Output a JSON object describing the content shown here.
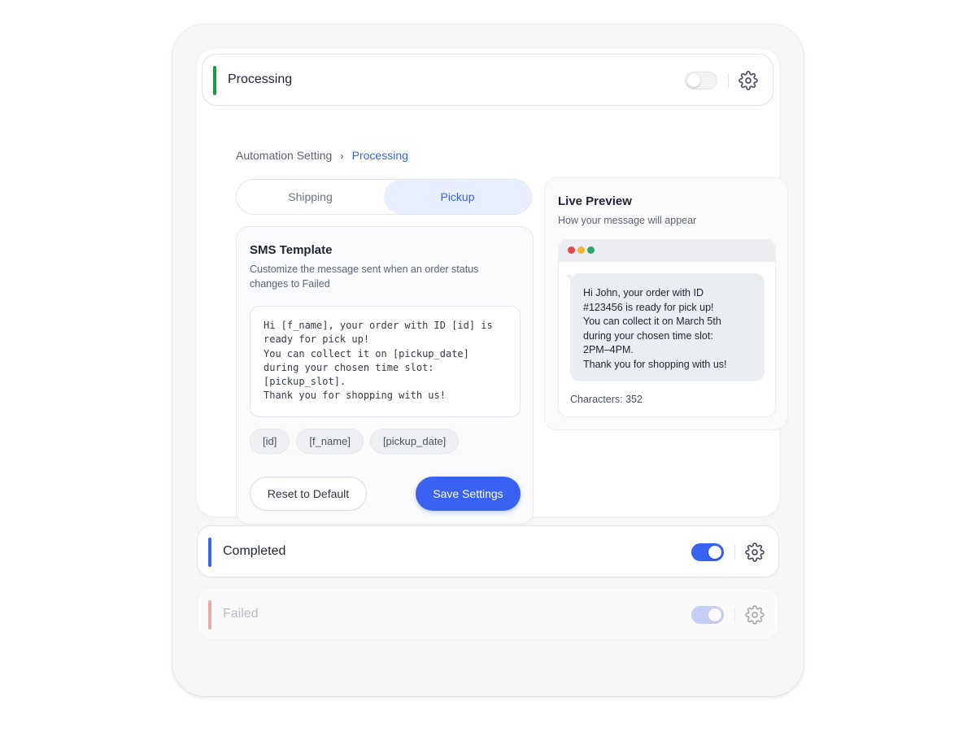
{
  "processing": {
    "title": "Processing",
    "bar_color": "#1a9b4a",
    "toggle_on": false
  },
  "breadcrumb": {
    "parent": "Automation Setting",
    "separator": "›",
    "current": "Processing"
  },
  "tabs": [
    {
      "label": "Shipping",
      "active": false
    },
    {
      "label": "Pickup",
      "active": true
    }
  ],
  "sms_template": {
    "title": "SMS Template",
    "description": "Customize the message sent when an order status changes to Failed",
    "template_text": "Hi [f_name], your order with ID [id] is\nready for pick up!\nYou can collect it on [pickup_date]\nduring your chosen time slot:\n[pickup_slot].\nThank you for shopping with us!",
    "chips": [
      "[id]",
      "[f_name]",
      "[pickup_date]"
    ],
    "reset_label": "Reset to Default",
    "save_label": "Save Settings"
  },
  "live_preview": {
    "title": "Live Preview",
    "subtitle": "How your message will appear",
    "message": "Hi John, your order with ID\n#123456 is ready for pick up!\nYou can collect it on March 5th\nduring your chosen time slot:\n2PM–4PM.\nThank you for shopping with us!",
    "characters_label": "Characters: 352",
    "window_dots": [
      "#e5484d",
      "#f0b429",
      "#30a46c"
    ]
  },
  "completed": {
    "title": "Completed",
    "bar_color": "#3a62f2",
    "toggle_on": true
  },
  "failed": {
    "title": "Failed",
    "bar_color": "#e5484d",
    "toggle_on": true
  },
  "colors": {
    "accent": "#3a62f2",
    "tab_active_bg": "#e9efff"
  }
}
